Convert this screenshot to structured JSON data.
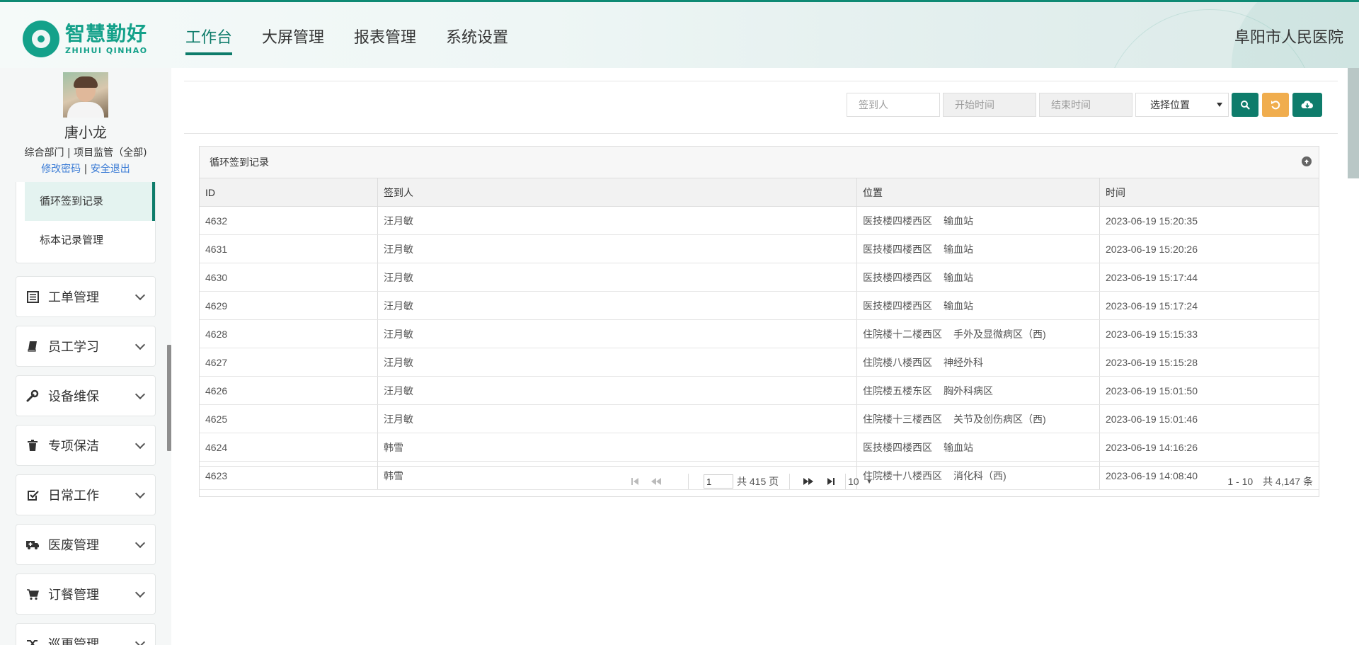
{
  "header": {
    "logo_cn": "智慧勤好",
    "logo_en": "ZHIHUI QINHAO",
    "nav": [
      {
        "label": "工作台",
        "active": true
      },
      {
        "label": "大屏管理",
        "active": false
      },
      {
        "label": "报表管理",
        "active": false
      },
      {
        "label": "系统设置",
        "active": false
      }
    ],
    "hospital": "阜阳市人民医院",
    "accent_color": "#0e7c6b"
  },
  "sidebar": {
    "user": {
      "name": "唐小龙",
      "dept": "综合部门 | 项目监管（全部)",
      "change_password": "修改密码",
      "separator": "|",
      "logout": "安全退出"
    },
    "submenu": [
      {
        "label": "循环签到记录",
        "active": true
      },
      {
        "label": "标本记录管理",
        "active": false
      }
    ],
    "menus": [
      {
        "label": "工单管理",
        "icon": "list-icon"
      },
      {
        "label": "员工学习",
        "icon": "book-icon"
      },
      {
        "label": "设备维保",
        "icon": "wrench-icon"
      },
      {
        "label": "专项保洁",
        "icon": "trash-icon"
      },
      {
        "label": "日常工作",
        "icon": "check-square-icon"
      },
      {
        "label": "医废管理",
        "icon": "ambulance-icon"
      },
      {
        "label": "订餐管理",
        "icon": "cart-icon"
      },
      {
        "label": "巡更管理",
        "icon": "random-icon"
      }
    ]
  },
  "toolbar": {
    "signer_placeholder": "签到人",
    "start_placeholder": "开始时间",
    "end_placeholder": "结束时间",
    "location_select": "选择位置",
    "search_color": "#0e7c6b",
    "reset_color": "#f0ad4e",
    "export_color": "#0e7c6b"
  },
  "grid": {
    "title": "循环签到记录",
    "columns": [
      "ID",
      "签到人",
      "位置",
      "时间"
    ],
    "rows": [
      {
        "id": "4632",
        "name": "汪月敏",
        "loc_a": "医技楼四楼西区",
        "loc_b": "输血站",
        "time": "2023-06-19 15:20:35"
      },
      {
        "id": "4631",
        "name": "汪月敏",
        "loc_a": "医技楼四楼西区",
        "loc_b": "输血站",
        "time": "2023-06-19 15:20:26"
      },
      {
        "id": "4630",
        "name": "汪月敏",
        "loc_a": "医技楼四楼西区",
        "loc_b": "输血站",
        "time": "2023-06-19 15:17:44"
      },
      {
        "id": "4629",
        "name": "汪月敏",
        "loc_a": "医技楼四楼西区",
        "loc_b": "输血站",
        "time": "2023-06-19 15:17:24"
      },
      {
        "id": "4628",
        "name": "汪月敏",
        "loc_a": "住院楼十二楼西区",
        "loc_b": "手外及显微病区（西)",
        "time": "2023-06-19 15:15:33"
      },
      {
        "id": "4627",
        "name": "汪月敏",
        "loc_a": "住院楼八楼西区",
        "loc_b": "神经外科",
        "time": "2023-06-19 15:15:28"
      },
      {
        "id": "4626",
        "name": "汪月敏",
        "loc_a": "住院楼五楼东区",
        "loc_b": "胸外科病区",
        "time": "2023-06-19 15:01:50"
      },
      {
        "id": "4625",
        "name": "汪月敏",
        "loc_a": "住院楼十三楼西区",
        "loc_b": "关节及创伤病区（西)",
        "time": "2023-06-19 15:01:46"
      },
      {
        "id": "4624",
        "name": "韩雪",
        "loc_a": "医技楼四楼西区",
        "loc_b": "输血站",
        "time": "2023-06-19 14:16:26"
      },
      {
        "id": "4623",
        "name": "韩雪",
        "loc_a": "住院楼十八楼西区",
        "loc_b": "消化科（西)",
        "time": "2023-06-19 14:08:40"
      }
    ],
    "pager": {
      "page": "1",
      "total_pages": "共 415 页",
      "page_size": "10",
      "range": "1 - 10",
      "total": "共 4,147 条"
    }
  }
}
